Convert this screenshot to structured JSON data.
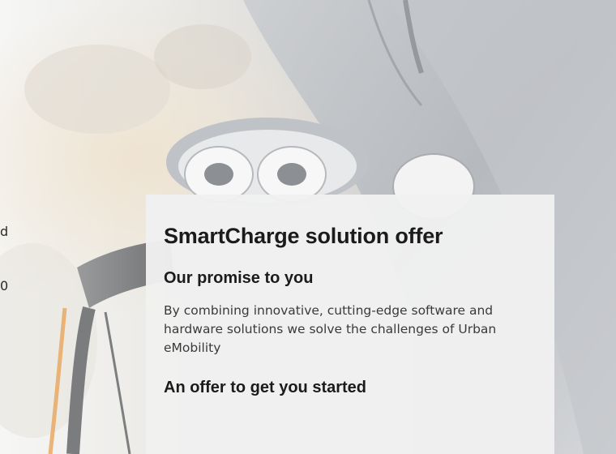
{
  "page": {
    "left_fragments": [
      "d",
      "0"
    ]
  },
  "offer": {
    "title": "SmartCharge solution offer",
    "promise_heading": "Our promise to you",
    "promise_body": "By combining innovative, cutting-edge software and hardware solutions we solve the challenges of Urban eMobility",
    "started_heading": "An offer to get you started"
  }
}
